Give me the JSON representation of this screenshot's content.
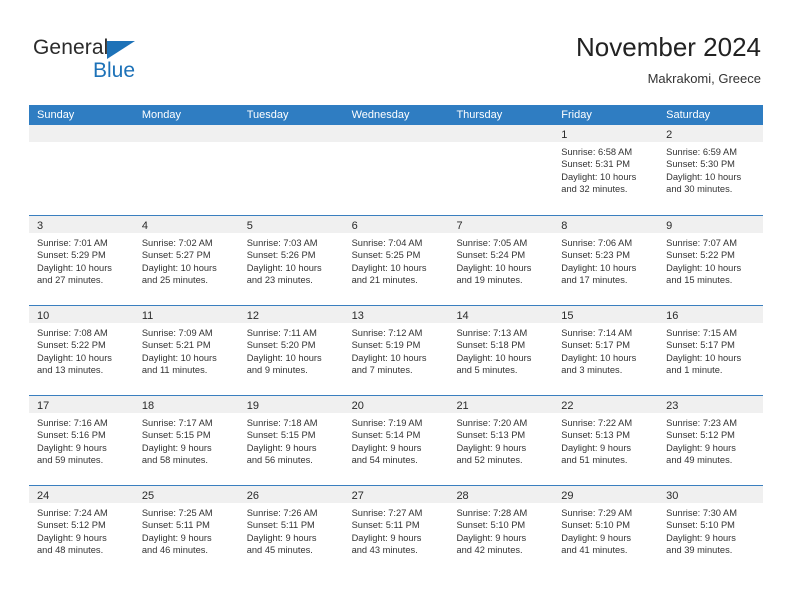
{
  "brand": {
    "name_top": "General",
    "name_bottom": "Blue",
    "accent_color": "#1d72b8"
  },
  "header": {
    "title": "November 2024",
    "subtitle": "Makrakomi, Greece"
  },
  "calendar": {
    "header_bg": "#2f7dc2",
    "daynum_bg": "#f0f0f0",
    "weekdays": [
      "Sunday",
      "Monday",
      "Tuesday",
      "Wednesday",
      "Thursday",
      "Friday",
      "Saturday"
    ],
    "weeks": [
      [
        {
          "day": "",
          "lines": []
        },
        {
          "day": "",
          "lines": []
        },
        {
          "day": "",
          "lines": []
        },
        {
          "day": "",
          "lines": []
        },
        {
          "day": "",
          "lines": []
        },
        {
          "day": "1",
          "lines": [
            "Sunrise: 6:58 AM",
            "Sunset: 5:31 PM",
            "Daylight: 10 hours",
            "and 32 minutes."
          ]
        },
        {
          "day": "2",
          "lines": [
            "Sunrise: 6:59 AM",
            "Sunset: 5:30 PM",
            "Daylight: 10 hours",
            "and 30 minutes."
          ]
        }
      ],
      [
        {
          "day": "3",
          "lines": [
            "Sunrise: 7:01 AM",
            "Sunset: 5:29 PM",
            "Daylight: 10 hours",
            "and 27 minutes."
          ]
        },
        {
          "day": "4",
          "lines": [
            "Sunrise: 7:02 AM",
            "Sunset: 5:27 PM",
            "Daylight: 10 hours",
            "and 25 minutes."
          ]
        },
        {
          "day": "5",
          "lines": [
            "Sunrise: 7:03 AM",
            "Sunset: 5:26 PM",
            "Daylight: 10 hours",
            "and 23 minutes."
          ]
        },
        {
          "day": "6",
          "lines": [
            "Sunrise: 7:04 AM",
            "Sunset: 5:25 PM",
            "Daylight: 10 hours",
            "and 21 minutes."
          ]
        },
        {
          "day": "7",
          "lines": [
            "Sunrise: 7:05 AM",
            "Sunset: 5:24 PM",
            "Daylight: 10 hours",
            "and 19 minutes."
          ]
        },
        {
          "day": "8",
          "lines": [
            "Sunrise: 7:06 AM",
            "Sunset: 5:23 PM",
            "Daylight: 10 hours",
            "and 17 minutes."
          ]
        },
        {
          "day": "9",
          "lines": [
            "Sunrise: 7:07 AM",
            "Sunset: 5:22 PM",
            "Daylight: 10 hours",
            "and 15 minutes."
          ]
        }
      ],
      [
        {
          "day": "10",
          "lines": [
            "Sunrise: 7:08 AM",
            "Sunset: 5:22 PM",
            "Daylight: 10 hours",
            "and 13 minutes."
          ]
        },
        {
          "day": "11",
          "lines": [
            "Sunrise: 7:09 AM",
            "Sunset: 5:21 PM",
            "Daylight: 10 hours",
            "and 11 minutes."
          ]
        },
        {
          "day": "12",
          "lines": [
            "Sunrise: 7:11 AM",
            "Sunset: 5:20 PM",
            "Daylight: 10 hours",
            "and 9 minutes."
          ]
        },
        {
          "day": "13",
          "lines": [
            "Sunrise: 7:12 AM",
            "Sunset: 5:19 PM",
            "Daylight: 10 hours",
            "and 7 minutes."
          ]
        },
        {
          "day": "14",
          "lines": [
            "Sunrise: 7:13 AM",
            "Sunset: 5:18 PM",
            "Daylight: 10 hours",
            "and 5 minutes."
          ]
        },
        {
          "day": "15",
          "lines": [
            "Sunrise: 7:14 AM",
            "Sunset: 5:17 PM",
            "Daylight: 10 hours",
            "and 3 minutes."
          ]
        },
        {
          "day": "16",
          "lines": [
            "Sunrise: 7:15 AM",
            "Sunset: 5:17 PM",
            "Daylight: 10 hours",
            "and 1 minute."
          ]
        }
      ],
      [
        {
          "day": "17",
          "lines": [
            "Sunrise: 7:16 AM",
            "Sunset: 5:16 PM",
            "Daylight: 9 hours",
            "and 59 minutes."
          ]
        },
        {
          "day": "18",
          "lines": [
            "Sunrise: 7:17 AM",
            "Sunset: 5:15 PM",
            "Daylight: 9 hours",
            "and 58 minutes."
          ]
        },
        {
          "day": "19",
          "lines": [
            "Sunrise: 7:18 AM",
            "Sunset: 5:15 PM",
            "Daylight: 9 hours",
            "and 56 minutes."
          ]
        },
        {
          "day": "20",
          "lines": [
            "Sunrise: 7:19 AM",
            "Sunset: 5:14 PM",
            "Daylight: 9 hours",
            "and 54 minutes."
          ]
        },
        {
          "day": "21",
          "lines": [
            "Sunrise: 7:20 AM",
            "Sunset: 5:13 PM",
            "Daylight: 9 hours",
            "and 52 minutes."
          ]
        },
        {
          "day": "22",
          "lines": [
            "Sunrise: 7:22 AM",
            "Sunset: 5:13 PM",
            "Daylight: 9 hours",
            "and 51 minutes."
          ]
        },
        {
          "day": "23",
          "lines": [
            "Sunrise: 7:23 AM",
            "Sunset: 5:12 PM",
            "Daylight: 9 hours",
            "and 49 minutes."
          ]
        }
      ],
      [
        {
          "day": "24",
          "lines": [
            "Sunrise: 7:24 AM",
            "Sunset: 5:12 PM",
            "Daylight: 9 hours",
            "and 48 minutes."
          ]
        },
        {
          "day": "25",
          "lines": [
            "Sunrise: 7:25 AM",
            "Sunset: 5:11 PM",
            "Daylight: 9 hours",
            "and 46 minutes."
          ]
        },
        {
          "day": "26",
          "lines": [
            "Sunrise: 7:26 AM",
            "Sunset: 5:11 PM",
            "Daylight: 9 hours",
            "and 45 minutes."
          ]
        },
        {
          "day": "27",
          "lines": [
            "Sunrise: 7:27 AM",
            "Sunset: 5:11 PM",
            "Daylight: 9 hours",
            "and 43 minutes."
          ]
        },
        {
          "day": "28",
          "lines": [
            "Sunrise: 7:28 AM",
            "Sunset: 5:10 PM",
            "Daylight: 9 hours",
            "and 42 minutes."
          ]
        },
        {
          "day": "29",
          "lines": [
            "Sunrise: 7:29 AM",
            "Sunset: 5:10 PM",
            "Daylight: 9 hours",
            "and 41 minutes."
          ]
        },
        {
          "day": "30",
          "lines": [
            "Sunrise: 7:30 AM",
            "Sunset: 5:10 PM",
            "Daylight: 9 hours",
            "and 39 minutes."
          ]
        }
      ]
    ]
  }
}
